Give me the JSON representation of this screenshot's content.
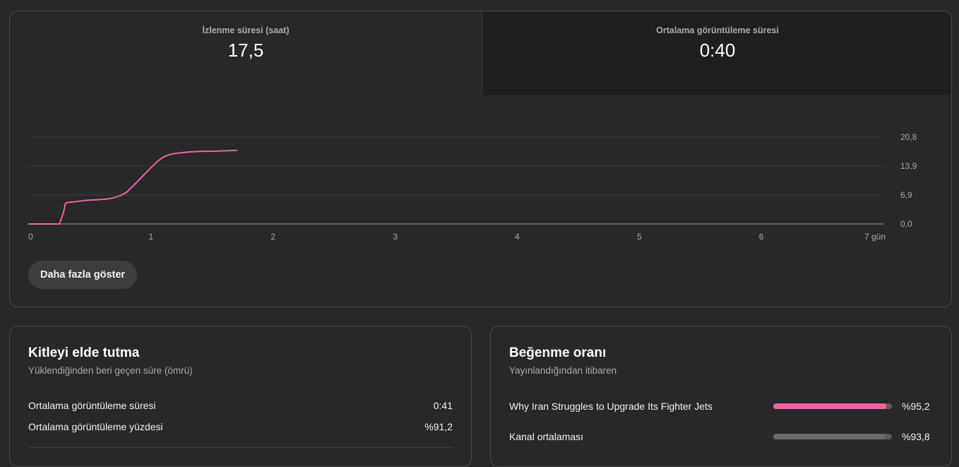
{
  "metrics": {
    "watch_time": {
      "label": "İzlenme süresi (saat)",
      "value": "17,5"
    },
    "avg_view_duration": {
      "label": "Ortalama görüntüleme süresi",
      "value": "0:40"
    }
  },
  "chart_data": {
    "type": "line",
    "title": "",
    "xlabel": "",
    "ylabel": "",
    "x_ticks": [
      "0",
      "1",
      "2",
      "3",
      "4",
      "5",
      "6",
      "7 gün"
    ],
    "y_ticks": [
      "0,0",
      "6,9",
      "13,9",
      "20,8"
    ],
    "xlim": [
      0,
      7
    ],
    "ylim": [
      0,
      20.8
    ],
    "grid": true,
    "color": "#f060a8",
    "series": [
      {
        "x": [
          0,
          0.1,
          0.2,
          0.25,
          0.28,
          0.3,
          0.33,
          0.4,
          0.45,
          0.5,
          0.55,
          0.6,
          0.65,
          0.7,
          0.75,
          0.8,
          0.85,
          0.9,
          0.95,
          1.0,
          1.05,
          1.1,
          1.15,
          1.2,
          1.3,
          1.4,
          1.5,
          1.6,
          1.7
        ],
        "y": [
          0,
          0,
          0,
          0,
          2.5,
          5.0,
          5.2,
          5.4,
          5.6,
          5.7,
          5.8,
          5.9,
          6.0,
          6.3,
          6.8,
          7.6,
          9.0,
          10.5,
          12.0,
          13.5,
          14.9,
          16.0,
          16.6,
          16.9,
          17.2,
          17.4,
          17.4,
          17.5,
          17.6
        ]
      }
    ]
  },
  "show_more_label": "Daha fazla göster",
  "retention": {
    "title": "Kitleyi elde tutma",
    "subtitle": "Yüklendiğinden beri geçen süre (ömrü)",
    "rows": [
      {
        "label": "Ortalama görüntüleme süresi",
        "value": "0:41"
      },
      {
        "label": "Ortalama görüntüleme yüzdesi",
        "value": "%91,2"
      }
    ]
  },
  "likes": {
    "title": "Beğenme oranı",
    "subtitle": "Yayınlandığından itibaren",
    "rows": [
      {
        "label": "Why Iran Struggles to Upgrade Its Fighter Jets",
        "value": "%95,2",
        "fraction": 0.952,
        "color": "#f060a8"
      },
      {
        "label": "Kanal ortalaması",
        "value": "%93,8",
        "fraction": 0.938,
        "color": "#6b6b6b"
      }
    ]
  }
}
